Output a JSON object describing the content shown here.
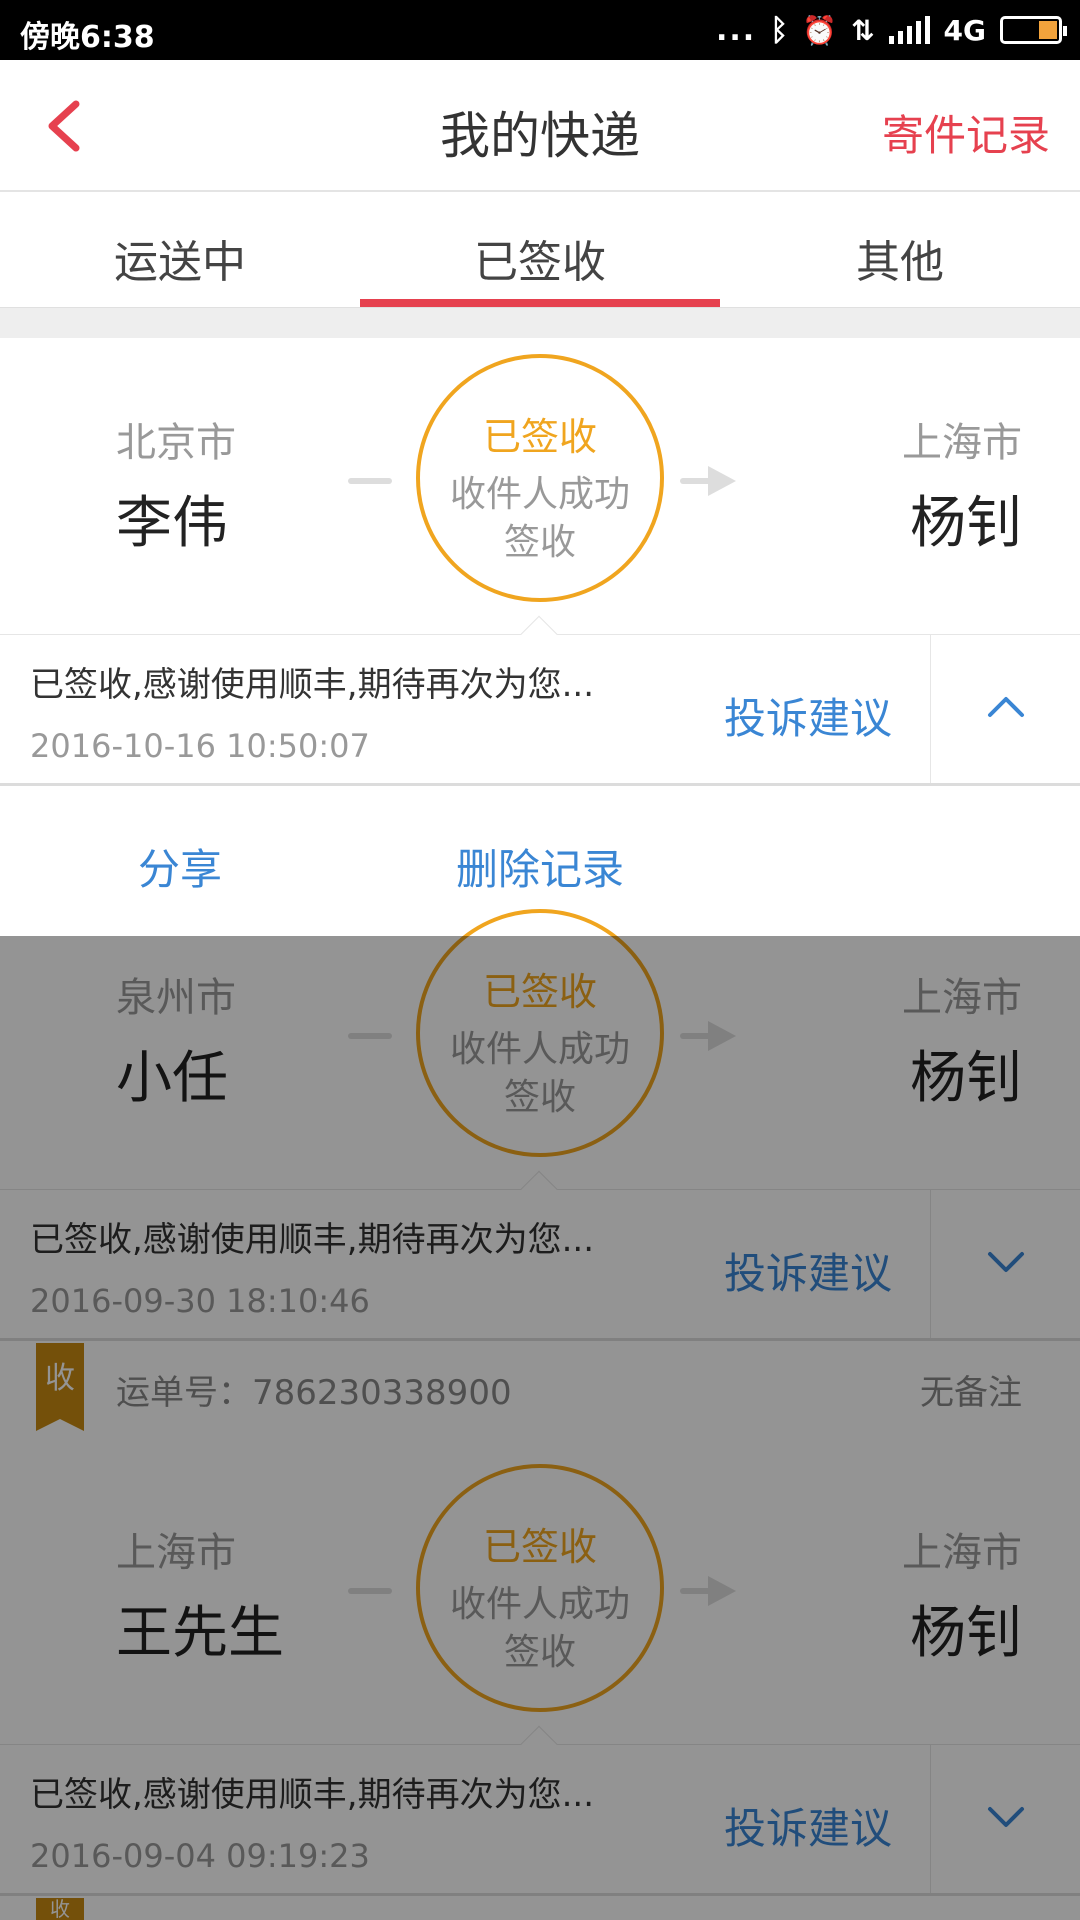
{
  "status_bar": {
    "time": "傍晚6:38",
    "network": "4G",
    "dots": "..."
  },
  "header": {
    "title": "我的快递",
    "right_action": "寄件记录"
  },
  "tabs": [
    {
      "label": "运送中",
      "active": false
    },
    {
      "label": "已签收",
      "active": true
    },
    {
      "label": "其他",
      "active": false
    }
  ],
  "colors": {
    "accent": "#e6414f",
    "link": "#3a86d4",
    "status_ring": "#f0a51f"
  },
  "shipments": [
    {
      "from_city": "北京市",
      "from_name": "李伟",
      "to_city": "上海市",
      "to_name": "杨钊",
      "status": "已签收",
      "status_desc": "收件人成功签收",
      "message": "已签收,感谢使用顺丰,期待再次为您...",
      "timestamp": "2016-10-16 10:50:07",
      "complain": "投诉建议",
      "expanded": true
    },
    {
      "from_city": "泉州市",
      "from_name": "小任",
      "to_city": "上海市",
      "to_name": "杨钊",
      "status": "已签收",
      "status_desc": "收件人成功签收",
      "message": "已签收,感谢使用顺丰,期待再次为您...",
      "timestamp": "2016-09-30 18:10:46",
      "complain": "投诉建议",
      "expanded": false
    },
    {
      "badge": "收",
      "waybill_label": "运单号：786230338900",
      "note": "无备注",
      "from_city": "上海市",
      "from_name": "王先生",
      "to_city": "上海市",
      "to_name": "杨钊",
      "status": "已签收",
      "status_desc": "收件人成功签收",
      "message": "已签收,感谢使用顺丰,期待再次为您...",
      "timestamp": "2016-09-04 09:19:23",
      "complain": "投诉建议",
      "expanded": false
    }
  ],
  "actions": {
    "share": "分享",
    "delete": "删除记录"
  },
  "next_badge": "收"
}
